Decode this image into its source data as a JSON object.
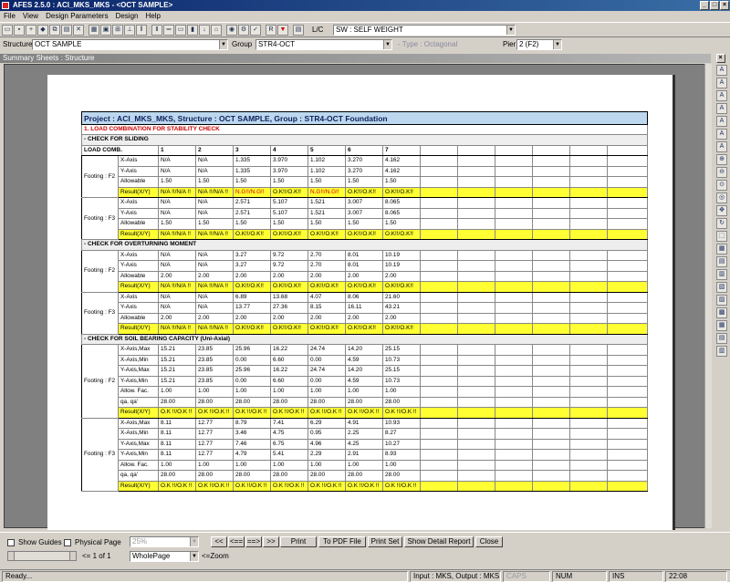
{
  "window": {
    "title": "AFES 2.5.0 : ACI_MKS_MKS - <OCT SAMPLE>"
  },
  "menu": [
    "File",
    "View",
    "Design Parameters",
    "Design",
    "Help"
  ],
  "toolbar": {
    "lc_label": "L/C",
    "load_case": "SW : SELF WEIGHT"
  },
  "structbar": {
    "structure_label": "Structure",
    "structure_value": "OCT SAMPLE",
    "group_label": "Group",
    "group_value": "STR4-OCT",
    "type_label": "- Type : Octagonal",
    "pier_label": "Pier",
    "pier_value": "2 (F2)"
  },
  "inner_window": {
    "title": "Summary Sheets : Structure"
  },
  "report": {
    "project_title": "Project : ACI_MKS_MKS, Structure : OCT SAMPLE, Group : STR4-OCT Foundation",
    "section_1": "1. LOAD COMBINATION FOR STABILITY CHECK",
    "sliding_header": "- CHECK FOR SLIDING",
    "load_comb_label": "LOAD COMB.",
    "columns": [
      "1",
      "2",
      "3",
      "4",
      "5",
      "6",
      "7"
    ],
    "overturning_header": "- CHECK FOR OVERTURNING MOMENT",
    "bearing_header": "- CHECK FOR SOIL BEARING CAPACITY (Uni-Axial)",
    "blocks": [
      {
        "footing": "Footing : F2",
        "rows": [
          {
            "label": "X-Axis",
            "values": [
              "N/A",
              "N/A",
              "1.335",
              "3.970",
              "1.102",
              "3.270",
              "4.162"
            ]
          },
          {
            "label": "Y-Axis",
            "values": [
              "N/A",
              "N/A",
              "1.335",
              "3.970",
              "1.102",
              "3.270",
              "4.162"
            ]
          },
          {
            "label": "Allowable",
            "values": [
              "1.50",
              "1.50",
              "1.50",
              "1.50",
              "1.50",
              "1.50",
              "1.50"
            ]
          },
          {
            "label": "Result(X/Y)",
            "values": [
              "N/A !!/N/A !!",
              "N/A !!/N/A !!",
              "N.G!!/N.G!!",
              "O.K!!/O.K!!",
              "N.G!!/N.G!!",
              "O.K!!/O.K!!",
              "O.K!!/O.K!!"
            ]
          }
        ]
      },
      {
        "footing": "Footing : F3",
        "rows": [
          {
            "label": "X-Axis",
            "values": [
              "N/A",
              "N/A",
              "2.571",
              "5.107",
              "1.521",
              "3.007",
              "8.065"
            ]
          },
          {
            "label": "Y-Axis",
            "values": [
              "N/A",
              "N/A",
              "2.571",
              "5.107",
              "1.521",
              "3.007",
              "8.065"
            ]
          },
          {
            "label": "Allowable",
            "values": [
              "1.50",
              "1.50",
              "1.50",
              "1.50",
              "1.50",
              "1.50",
              "1.50"
            ]
          },
          {
            "label": "Result(X/Y)",
            "values": [
              "N/A !!/N/A !!",
              "N/A !!/N/A !!",
              "O.K!!/O.K!!",
              "O.K!!/O.K!!",
              "O.K!!/O.K!!",
              "O.K!!/O.K!!",
              "O.K!!/O.K!!"
            ]
          }
        ]
      },
      {
        "footing": "Footing : F2",
        "rows": [
          {
            "label": "X-Axis",
            "values": [
              "N/A",
              "N/A",
              "3.27",
              "9.72",
              "2.70",
              "8.01",
              "10.19"
            ]
          },
          {
            "label": "Y-Axis",
            "values": [
              "N/A",
              "N/A",
              "3.27",
              "9.72",
              "2.70",
              "8.01",
              "10.19"
            ]
          },
          {
            "label": "Allowable",
            "values": [
              "2.00",
              "2.00",
              "2.00",
              "2.00",
              "2.00",
              "2.00",
              "2.00"
            ]
          },
          {
            "label": "Result(X/Y)",
            "values": [
              "N/A !!/N/A !!",
              "N/A !!/N/A !!",
              "O.K!!/O.K!!",
              "O.K!!/O.K!!",
              "O.K!!/O.K!!",
              "O.K!!/O.K!!",
              "O.K!!/O.K!!"
            ]
          }
        ]
      },
      {
        "footing": "Footing : F3",
        "rows": [
          {
            "label": "X-Axis",
            "values": [
              "N/A",
              "N/A",
              "6.89",
              "13.68",
              "4.07",
              "8.06",
              "21.60"
            ]
          },
          {
            "label": "Y-Axis",
            "values": [
              "N/A",
              "N/A",
              "13.77",
              "27.36",
              "8.15",
              "16.11",
              "43.21"
            ]
          },
          {
            "label": "Allowable",
            "values": [
              "2.00",
              "2.00",
              "2.00",
              "2.00",
              "2.00",
              "2.00",
              "2.00"
            ]
          },
          {
            "label": "Result(X/Y)",
            "values": [
              "N/A !!/N/A !!",
              "N/A !!/N/A !!",
              "O.K!!/O.K!!",
              "O.K!!/O.K!!",
              "O.K!!/O.K!!",
              "O.K!!/O.K!!",
              "O.K!!/O.K!!"
            ]
          }
        ]
      },
      {
        "footing": "Footing : F2",
        "rows": [
          {
            "label": "X-Axis,Max",
            "values": [
              "15.21",
              "23.85",
              "25.96",
              "16.22",
              "24.74",
              "14.20",
              "25.15"
            ]
          },
          {
            "label": "X-Axis,Min",
            "values": [
              "15.21",
              "23.85",
              "0.00",
              "6.60",
              "0.00",
              "4.59",
              "10.73"
            ]
          },
          {
            "label": "Y-Axis,Max",
            "values": [
              "15.21",
              "23.85",
              "25.96",
              "16.22",
              "24.74",
              "14.20",
              "25.15"
            ]
          },
          {
            "label": "Y-Axis,Min",
            "values": [
              "15.21",
              "23.85",
              "0.00",
              "6.60",
              "0.00",
              "4.59",
              "10.73"
            ]
          },
          {
            "label": "Allow. Fac.",
            "values": [
              "1.00",
              "1.00",
              "1.00",
              "1.00",
              "1.00",
              "1.00",
              "1.00"
            ]
          },
          {
            "label": "qa, qa'",
            "values": [
              "28.00",
              "28.00",
              "28.00",
              "28.00",
              "28.00",
              "28.00",
              "28.00"
            ]
          },
          {
            "label": "Result(X/Y)",
            "values": [
              "O.K !!/O.K !!",
              "O.K !!/O.K !!",
              "O.K !!/O.K !!",
              "O.K !!/O.K !!",
              "O.K !!/O.K !!",
              "O.K !!/O.K !!",
              "O.K !!/O.K !!"
            ]
          }
        ]
      },
      {
        "footing": "Footing : F3",
        "rows": [
          {
            "label": "X-Axis,Max",
            "values": [
              "8.11",
              "12.77",
              "8.79",
              "7.41",
              "6.29",
              "4.91",
              "10.93"
            ]
          },
          {
            "label": "X-Axis,Min",
            "values": [
              "8.11",
              "12.77",
              "3.46",
              "4.75",
              "0.95",
              "2.25",
              "8.27"
            ]
          },
          {
            "label": "Y-Axis,Max",
            "values": [
              "8.11",
              "12.77",
              "7.46",
              "6.75",
              "4.96",
              "4.25",
              "10.27"
            ]
          },
          {
            "label": "Y-Axis,Min",
            "values": [
              "8.11",
              "12.77",
              "4.79",
              "5.41",
              "2.29",
              "2.91",
              "8.93"
            ]
          },
          {
            "label": "Allow. Fac.",
            "values": [
              "1.00",
              "1.00",
              "1.00",
              "1.00",
              "1.00",
              "1.00",
              "1.00"
            ]
          },
          {
            "label": "qa, qa'",
            "values": [
              "28.00",
              "28.00",
              "28.00",
              "28.00",
              "28.00",
              "28.00",
              "28.00"
            ]
          },
          {
            "label": "Result(X/Y)",
            "values": [
              "O.K !!/O.K !!",
              "O.K !!/O.K !!",
              "O.K !!/O.K !!",
              "O.K !!/O.K !!",
              "O.K !!/O.K !!",
              "O.K !!/O.K !!",
              "O.K !!/O.K !!"
            ]
          }
        ]
      }
    ]
  },
  "bottom": {
    "show_guides": "Show Guides",
    "physical_page": "Physical Page",
    "zoom_percent": "25%",
    "first": "<<",
    "prev": "<==",
    "next": "==>",
    "last": ">>",
    "print": "Print",
    "pdf": "To PDF File",
    "print_set": "Print Set",
    "show_detail": "Show Detail Report",
    "close": "Close",
    "page_info": "<= 1 of 1",
    "zoom_mode": "WholePage",
    "zoom_label": "<=Zoom"
  },
  "status": {
    "ready": "Ready...",
    "io": "Input : MKS,  Output : MKS",
    "caps": "CAPS",
    "num": "NUM",
    "ins": "INS",
    "time": "22:08"
  }
}
